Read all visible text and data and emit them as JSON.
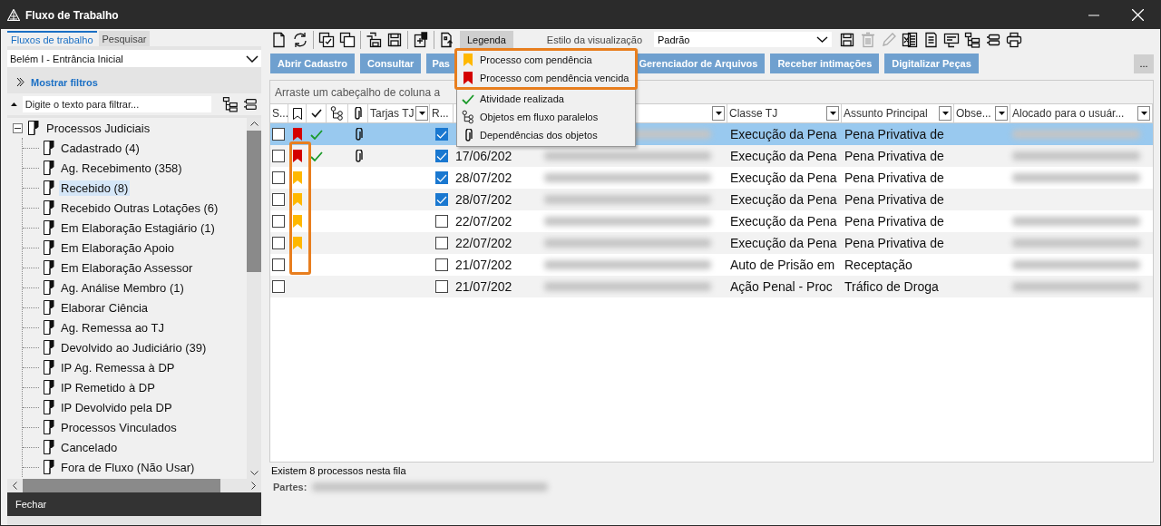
{
  "window": {
    "title": "Fluxo de Trabalho"
  },
  "left_panel": {
    "tabs": [
      {
        "label": "Fluxos de trabalho",
        "selected": true
      },
      {
        "label": "Pesquisar",
        "selected": false
      }
    ],
    "location": {
      "value": "Belém I - Entrância Inicial"
    },
    "filters_link": "Mostrar filtros",
    "filter_field": {
      "placeholder": "Digite o texto para filtrar..."
    },
    "tree": [
      {
        "label": "Processos Judiciais",
        "expanded": true,
        "selected": false,
        "children": [
          {
            "label": "Cadastrado (4)",
            "selected": false
          },
          {
            "label": "Ag. Recebimento (358)",
            "selected": false
          },
          {
            "label": "Recebido (8)",
            "selected": true
          },
          {
            "label": "Recebido Outras Lotações (6)",
            "selected": false
          },
          {
            "label": "Em Elaboração Estagiário (1)",
            "selected": false
          },
          {
            "label": "Em Elaboração Apoio",
            "selected": false
          },
          {
            "label": "Em Elaboração Assessor",
            "selected": false
          },
          {
            "label": "Ag. Análise Membro (1)",
            "selected": false
          },
          {
            "label": "Elaborar Ciência",
            "selected": false
          },
          {
            "label": "Ag. Remessa ao TJ",
            "selected": false
          },
          {
            "label": "Devolvido ao Judiciário (39)",
            "selected": false
          },
          {
            "label": "IP Ag. Remessa à DP",
            "selected": false
          },
          {
            "label": "IP Remetido à DP",
            "selected": false
          },
          {
            "label": "IP Devolvido pela DP",
            "selected": false
          },
          {
            "label": "Processos Vinculados",
            "selected": false
          },
          {
            "label": "Cancelado",
            "selected": false
          },
          {
            "label": "Fora de Fluxo (Não Usar)",
            "selected": false
          }
        ]
      }
    ],
    "close_button": "Fechar"
  },
  "toolbar": {
    "legend_button": {
      "label": "Legenda",
      "expanded": true
    },
    "view_style_label": "Estilo da visualização",
    "view_style": {
      "value": "Padrão"
    }
  },
  "action_buttons": [
    "Abrir Cadastro",
    "Consultar",
    "Pas",
    "Gerenciador de Arquivos",
    "Receber intimações",
    "Digitalizar Peças"
  ],
  "overflow_button": "...",
  "group_hint": "Arraste um cabeçalho de coluna a",
  "table": {
    "columns": [
      "S...",
      "Tarjas TJ",
      "R...",
      "Classe TJ",
      "Assunto Principal",
      "Obse...",
      "Alocado para o usuár..."
    ],
    "rows": [
      {
        "selected": true,
        "checked": false,
        "pending": false,
        "overdue": true,
        "done": true,
        "attachment": true,
        "received": true,
        "classe": "Execução da Pena",
        "assunto": "Pena Privativa de"
      },
      {
        "selected": false,
        "checked": false,
        "pending": false,
        "overdue": true,
        "done": true,
        "attachment": true,
        "received": true,
        "date": "17/06/202",
        "classe": "Execução da Pena",
        "assunto": "Pena Privativa de"
      },
      {
        "selected": false,
        "checked": false,
        "pending": true,
        "overdue": false,
        "done": false,
        "attachment": false,
        "received": true,
        "date": "28/07/202",
        "classe": "Execução da Pena",
        "assunto": "Pena Privativa de"
      },
      {
        "selected": false,
        "checked": false,
        "pending": true,
        "overdue": false,
        "done": false,
        "attachment": false,
        "received": true,
        "date": "28/07/202",
        "classe": "Execução da Pena",
        "assunto": "Pena Privativa de"
      },
      {
        "selected": false,
        "checked": false,
        "pending": true,
        "overdue": false,
        "done": false,
        "attachment": false,
        "received": false,
        "date": "22/07/202",
        "classe": "Execução da Pena",
        "assunto": "Pena Privativa de"
      },
      {
        "selected": false,
        "checked": false,
        "pending": true,
        "overdue": false,
        "done": false,
        "attachment": false,
        "received": false,
        "date": "22/07/202",
        "classe": "Execução da Pena",
        "assunto": "Pena Privativa de"
      },
      {
        "selected": false,
        "checked": false,
        "pending": false,
        "overdue": false,
        "done": false,
        "attachment": false,
        "received": false,
        "date": "21/07/202",
        "classe": "Auto de Prisão em",
        "assunto": "Receptação"
      },
      {
        "selected": false,
        "checked": false,
        "pending": false,
        "overdue": false,
        "done": false,
        "attachment": false,
        "received": false,
        "date": "21/07/202",
        "classe": "Ação Penal - Proc",
        "assunto": "Tráfico de Droga"
      }
    ]
  },
  "legend_menu": [
    {
      "kind": "pending",
      "label": "Processo com pendência"
    },
    {
      "kind": "overdue",
      "label": "Processo com pendência vencida"
    },
    {
      "kind": "done",
      "label": "Atividade realizada"
    },
    {
      "kind": "parallel",
      "label": "Objetos em fluxo paralelos"
    },
    {
      "kind": "dependency",
      "label": "Dependências dos objetos"
    }
  ],
  "status": {
    "count": "Existem 8 processos nesta fila",
    "parties_label": "Partes:"
  }
}
